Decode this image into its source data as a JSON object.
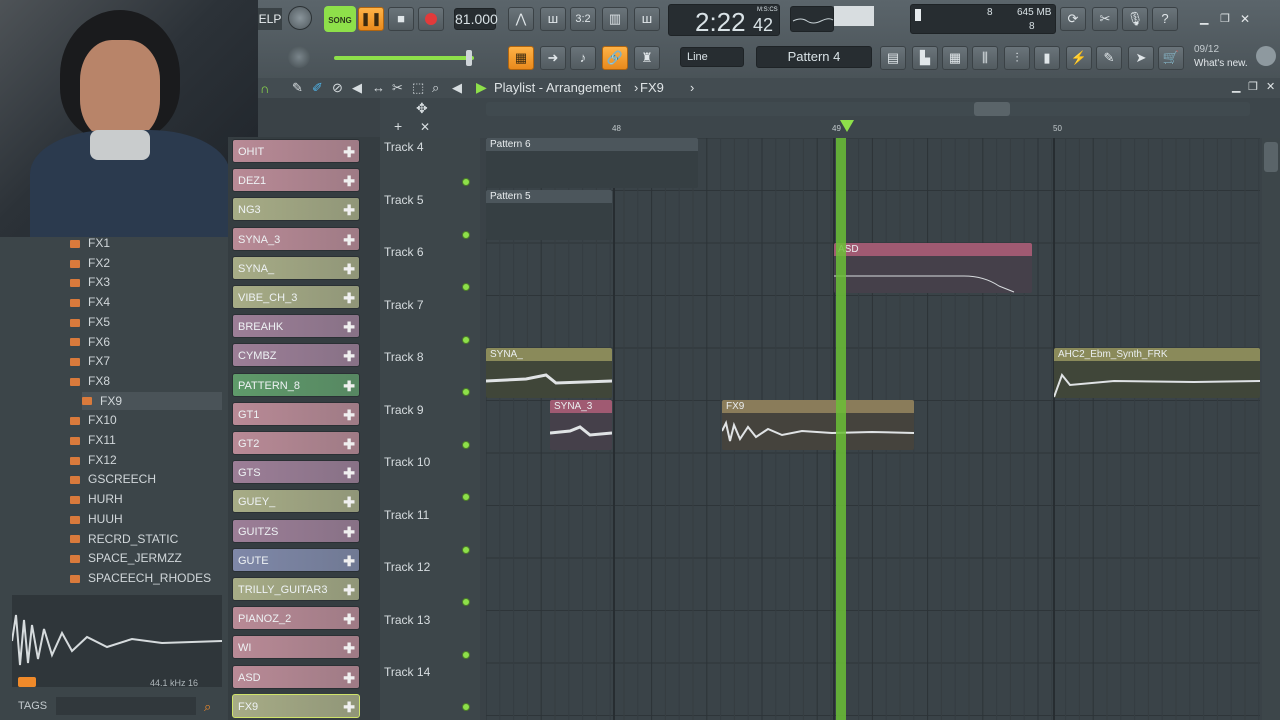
{
  "toolbar": {
    "help_label": "ELP",
    "song_label": "SONG",
    "tempo": "81.000",
    "time_main": "2:22",
    "time_frac": "42",
    "time_unit": "M:S:CS",
    "cpu_label": "8",
    "mem_label": "645 MB",
    "poly_label": "8",
    "snap_label": "Line",
    "pattern_label": "Pattern 4",
    "news_date": "09/12",
    "news_label": "What's new."
  },
  "playlist": {
    "title": "Playlist - Arrangement",
    "current": "FX9",
    "bars": [
      "48",
      "49",
      "50"
    ]
  },
  "browser": {
    "items": [
      "FX1",
      "FX2",
      "FX3",
      "FX4",
      "FX5",
      "FX6",
      "FX7",
      "FX8",
      "FX9",
      "FX10",
      "FX11",
      "FX12",
      "GSCREECH",
      "HURH",
      "HUUH",
      "RECRD_STATIC",
      "SPACE_JERMZZ",
      "SPACEECH_RHODES"
    ],
    "selected": "FX9",
    "sample_info": "44.1 kHz 16",
    "tags_label": "TAGS"
  },
  "channels": [
    {
      "name": "OHIT",
      "color": "#b98a96"
    },
    {
      "name": "DEZ1",
      "color": "#b98a96"
    },
    {
      "name": "NG3",
      "color": "#a7ac86"
    },
    {
      "name": "SYNA_3",
      "color": "#b98a96"
    },
    {
      "name": "SYNA_",
      "color": "#a7ac86"
    },
    {
      "name": "VIBE_CH_3",
      "color": "#a7ac86"
    },
    {
      "name": "BREAHK",
      "color": "#9c7e97"
    },
    {
      "name": "CYMBZ",
      "color": "#9c7e97"
    },
    {
      "name": "PATTERN_8",
      "color": "#5f9a6a"
    },
    {
      "name": "GT1",
      "color": "#b98a96"
    },
    {
      "name": "GT2",
      "color": "#b98a96"
    },
    {
      "name": "GTS",
      "color": "#9c7e97"
    },
    {
      "name": "GUEY_",
      "color": "#a7ac86"
    },
    {
      "name": "GUITZS",
      "color": "#9c7e97"
    },
    {
      "name": "GUTE",
      "color": "#7f88a8"
    },
    {
      "name": "TRILLY_GUITAR3",
      "color": "#a7ac86"
    },
    {
      "name": "PIANOZ_2",
      "color": "#b98a96"
    },
    {
      "name": "WI",
      "color": "#b98a96"
    },
    {
      "name": "ASD",
      "color": "#b98a96"
    },
    {
      "name": "FX9",
      "color": "#a7ac86"
    }
  ],
  "tracks": [
    "Track 4",
    "Track 5",
    "Track 6",
    "Track 7",
    "Track 8",
    "Track 9",
    "Track 10",
    "Track 11",
    "Track 12",
    "Track 13",
    "Track 14"
  ],
  "clips": [
    {
      "name": "Pattern 6",
      "color": "#4c565c"
    },
    {
      "name": "Pattern 5",
      "color": "#4c565c"
    },
    {
      "name": "ASD",
      "color": "#a05a72"
    },
    {
      "name": "SYNA_",
      "color": "#8a8a5a"
    },
    {
      "name": "AHC2_Ebm_Synth_FRK",
      "color": "#8a8a5a"
    },
    {
      "name": "SYNA_3",
      "color": "#a05a72"
    },
    {
      "name": "FX9",
      "color": "#8a7c5a"
    }
  ]
}
